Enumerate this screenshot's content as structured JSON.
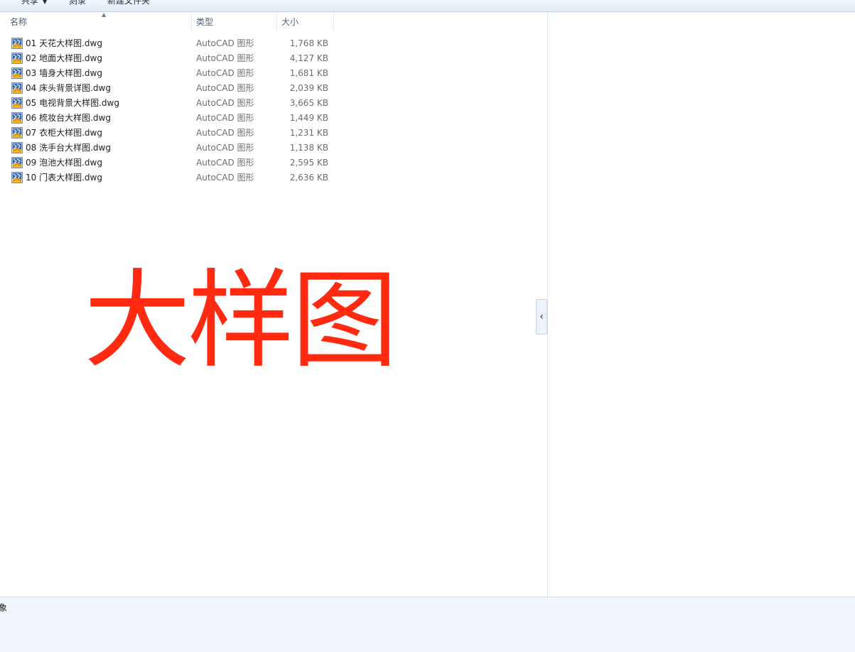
{
  "toolbar": {
    "share_label": "共享",
    "burn_label": "刻录",
    "new_folder_label": "新建文件夹"
  },
  "columns": {
    "name": "名称",
    "type": "类型",
    "size": "大小"
  },
  "files": [
    {
      "name": "01 天花大样图.dwg",
      "type": "AutoCAD 图形",
      "size": "1,768 KB"
    },
    {
      "name": "02 地面大样图.dwg",
      "type": "AutoCAD 图形",
      "size": "4,127 KB"
    },
    {
      "name": "03 墙身大样图.dwg",
      "type": "AutoCAD 图形",
      "size": "1,681 KB"
    },
    {
      "name": "04 床头背景详图.dwg",
      "type": "AutoCAD 图形",
      "size": "2,039 KB"
    },
    {
      "name": "05 电视背景大样图.dwg",
      "type": "AutoCAD 图形",
      "size": "3,665 KB"
    },
    {
      "name": "06 梳妆台大样图.dwg",
      "type": "AutoCAD 图形",
      "size": "1,449 KB"
    },
    {
      "name": "07 衣柜大样图.dwg",
      "type": "AutoCAD 图形",
      "size": "1,231 KB"
    },
    {
      "name": "08 洗手台大样图.dwg",
      "type": "AutoCAD 图形",
      "size": "1,138 KB"
    },
    {
      "name": "09 泡池大样图.dwg",
      "type": "AutoCAD 图形",
      "size": "2,595 KB"
    },
    {
      "name": "10 门表大样图.dwg",
      "type": "AutoCAD 图形",
      "size": "2,636 KB"
    }
  ],
  "overlay": {
    "text": "大样图",
    "color": "#ff2a0f"
  },
  "preview": {
    "collapse_glyph": "‹"
  },
  "status": {
    "text": "象"
  },
  "icons": {
    "file": "autocad-dwg-icon",
    "sort": "sort-ascending-icon",
    "collapse": "chevron-left-icon"
  }
}
